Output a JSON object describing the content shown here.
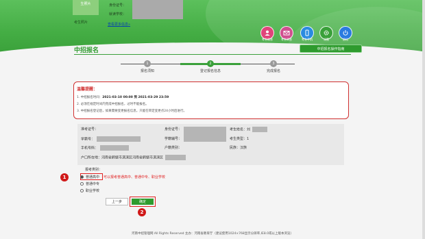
{
  "header": {
    "photo_box_text": "生照片",
    "photo_label": "考生照片",
    "id_label": "身份证号：",
    "school_label": "就读学校：",
    "more_link": "查看更多信息»",
    "guide_button": "中招报名操作指南",
    "actions": [
      {
        "label": "考生信息",
        "icon": "user-icon",
        "color": "#e0447a"
      },
      {
        "label": "考生消息",
        "icon": "mail-icon",
        "color": "#d04f8f"
      },
      {
        "label": "考生手机",
        "icon": "phone-icon",
        "color": "#2a8be0"
      },
      {
        "label": "设置",
        "icon": "gear-icon",
        "color": "#3aa03a"
      },
      {
        "label": "退出",
        "icon": "power-icon",
        "color": "#2a7be0"
      }
    ]
  },
  "page": {
    "title": "中招报名"
  },
  "steps": [
    {
      "num": "1",
      "label": "报名须知",
      "active": false
    },
    {
      "num": "2",
      "label": "登记报名信息",
      "active": true
    },
    {
      "num": "3",
      "label": "完成报名",
      "active": false
    }
  ],
  "notice": {
    "title": "温馨提醒：",
    "item1_prefix": "1. 中招报名时间：",
    "item1_time": "2021-03-10 00:00 到 2021-03-29 23:59",
    "item2": "2. 必须在规定时间内完成中招报名，过时不能报名。",
    "item3": "3. 中招报名登记后，如果需要变更报名信息，只能在审定变更点24小时后进行。"
  },
  "info": {
    "exam_no": "准考证号：",
    "id_no": "身份证号：",
    "name": "考生姓名：",
    "name_value": "刘",
    "student_no": "学籍号：",
    "school_no": "学籍辅号：",
    "type": "考生类型：",
    "type_value": "1",
    "phone": "手机号码：",
    "household": "户籍类别：",
    "ethnicity": "民族：",
    "ethnicity_value": "汉族",
    "address": "户口所在地：",
    "address_value": "河南省鹤壁市淇滨区河南省鹤壁市淇滨区"
  },
  "category": {
    "label": "报考类别：",
    "options": [
      "普通高中",
      "普通中专",
      "职业学校"
    ],
    "selected": 0,
    "hint": "可以报考普通高中、普通中专、职业学校"
  },
  "markers": {
    "one": "1",
    "two": "2"
  },
  "buttons": {
    "prev": "上一步",
    "ok": "确定"
  },
  "footer": "河南中招管理网 All Rights Reserved 主办：河南省教育厅（建议使用1024×768显示分辨率,IE8.0或以上版本浏览）"
}
